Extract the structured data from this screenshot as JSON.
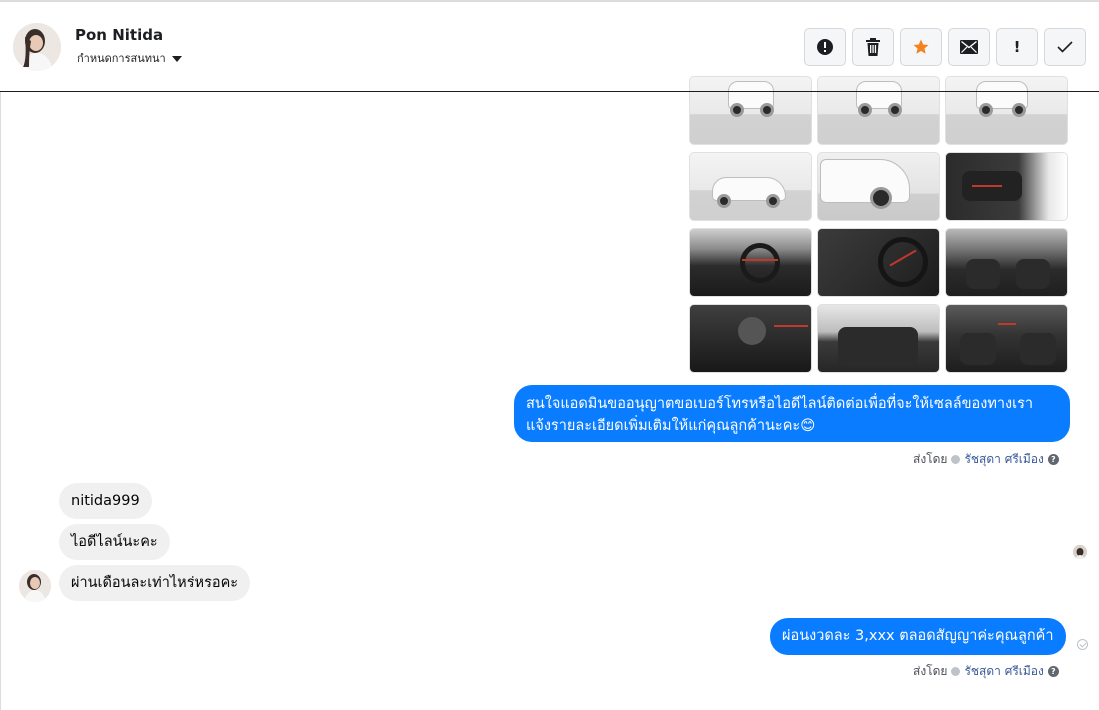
{
  "header": {
    "contact_name": "Pon Nitida",
    "assign_label": "กำหนดการสนทนา",
    "toolbar": [
      {
        "name": "mark-spam-button",
        "icon": "alert-circle-icon"
      },
      {
        "name": "delete-button",
        "icon": "trash-icon"
      },
      {
        "name": "star-button",
        "icon": "star-icon"
      },
      {
        "name": "mark-unread-button",
        "icon": "envelope-icon"
      },
      {
        "name": "follow-up-button",
        "icon": "exclamation-icon"
      },
      {
        "name": "mark-done-button",
        "icon": "check-icon"
      }
    ]
  },
  "colors": {
    "outgoing_bubble": "#0a7cff",
    "incoming_bubble": "#f0f0f0",
    "star": "#f5821f",
    "sender_name": "#385898"
  },
  "photos": {
    "count": 12,
    "kinds": [
      "exterior",
      "exterior",
      "exterior",
      "exterior",
      "exterior",
      "interior",
      "interior",
      "interior",
      "interior",
      "interior",
      "interior",
      "interior"
    ]
  },
  "messages": {
    "outgoing_1": {
      "line1": "สนใจแอดมินขออนุญาตขอเบอร์โทรหรือไอดีไลน์ติดต่อเพื่อที่จะให้เซลล์ของทางเรา",
      "line2": "แจ้งรายละเอียดเพิ่มเติมให้แก่คุณลูกค้านะคะ😊"
    },
    "incoming": [
      {
        "text": "nitida999"
      },
      {
        "text": "ไอดีไลน์นะคะ"
      },
      {
        "text": "ผ่านเดือนละเท่าไหร่หรอคะ"
      }
    ],
    "outgoing_2": {
      "text": "ผ่อนงวดละ 3,xxx ตลอดสัญญาค่ะคุณลูกค้า"
    },
    "sent_by_label": "ส่งโดย",
    "sent_by_name": "รัชสุดา ศรีเมือง",
    "help_glyph": "?"
  }
}
